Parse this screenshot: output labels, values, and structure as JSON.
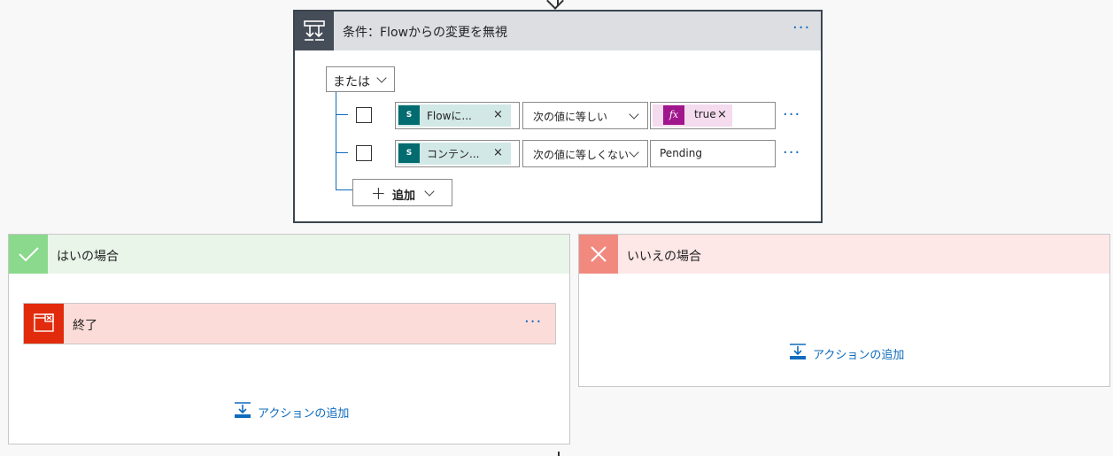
{
  "condition": {
    "title": "条件：Flowからの変更を無視",
    "more": "···",
    "group_operator": "または",
    "rows": [
      {
        "left_token": "Flowに...",
        "left_token_icon": "sharepoint-icon",
        "operator": "次の値に等しい",
        "right_token": "true",
        "right_token_icon": "fx-icon"
      },
      {
        "left_token": "コンテン...",
        "left_token_icon": "sharepoint-icon",
        "operator": "次の値に等しくない",
        "right_value": "Pending"
      }
    ],
    "add_label": "追加"
  },
  "yes_branch": {
    "title": "はいの場合",
    "actions": [
      {
        "title": "終了",
        "more": "···"
      }
    ],
    "add_action_label": "アクションの追加"
  },
  "no_branch": {
    "title": "いいえの場合",
    "add_action_label": "アクションの追加"
  },
  "colors": {
    "accent": "#0f6cbd",
    "condition_header": "#dcdee2",
    "condition_icon": "#454d58",
    "yes_header": "#e9f5e9",
    "yes_icon": "#8ad98c",
    "no_header": "#fde7e7",
    "no_icon": "#f1897f",
    "terminate_bg": "#fcdcd8",
    "terminate_icon": "#e22b0c",
    "sharepoint": "#036c70",
    "fx": "#a0168c"
  }
}
